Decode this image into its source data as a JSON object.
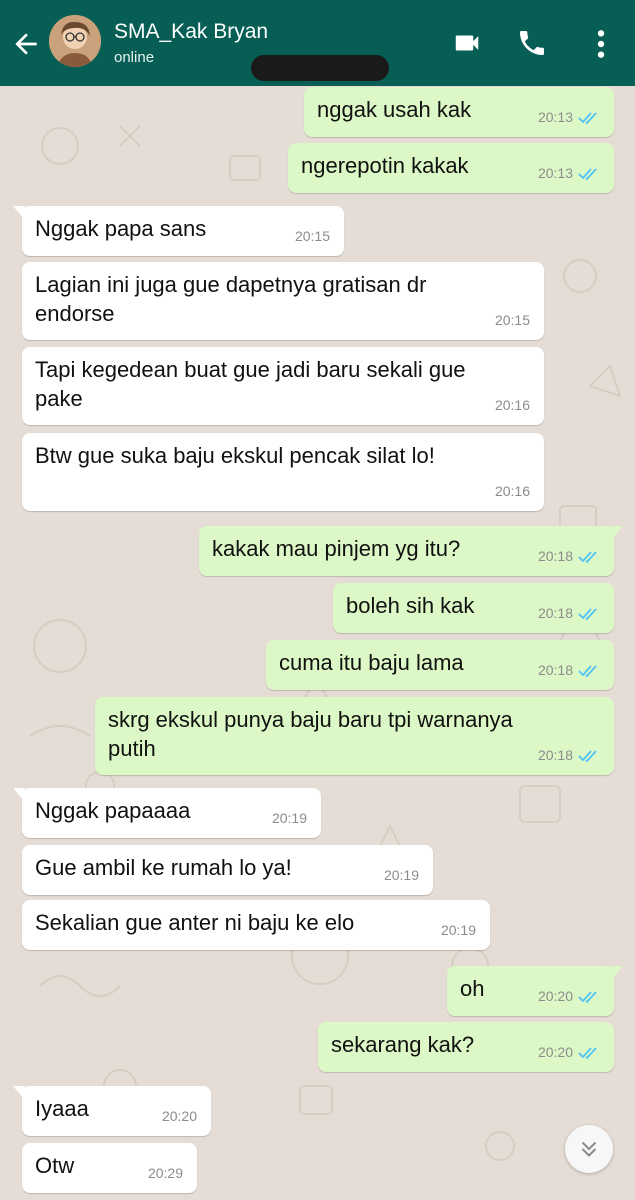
{
  "header": {
    "contact_name": "SMA_Kak Bryan",
    "status": "online",
    "icons": [
      "back-arrow-icon",
      "video-call-icon",
      "phone-icon",
      "more-vert-icon"
    ],
    "bg_color": "#075e54"
  },
  "colors": {
    "incoming_bubble": "#ffffff",
    "outgoing_bubble": "#dcf8c6",
    "read_tick": "#4fc3f7",
    "chat_background": "#e5ddd5"
  },
  "messages": [
    {
      "dir": "out",
      "text": "nggak usah kak",
      "time": "20:13",
      "read": true
    },
    {
      "dir": "out",
      "text": "ngerepotin kakak",
      "time": "20:13",
      "read": true
    },
    {
      "dir": "in",
      "text": "Nggak papa sans",
      "time": "20:15"
    },
    {
      "dir": "in",
      "text": "Lagian ini juga gue dapetnya gratisan dr\nendorse",
      "time": "20:15"
    },
    {
      "dir": "in",
      "text": "Tapi kegedean buat gue jadi baru sekali gue\npake",
      "time": "20:16"
    },
    {
      "dir": "in",
      "text": "Btw gue suka baju ekskul pencak silat lo!",
      "time": "20:16"
    },
    {
      "dir": "out",
      "text": "kakak mau pinjem yg itu?",
      "time": "20:18",
      "read": true
    },
    {
      "dir": "out",
      "text": "boleh sih kak",
      "time": "20:18",
      "read": true
    },
    {
      "dir": "out",
      "text": "cuma itu baju lama",
      "time": "20:18",
      "read": true
    },
    {
      "dir": "out",
      "text": "skrg ekskul punya baju baru tpi warnanya\nputih",
      "time": "20:18",
      "read": true
    },
    {
      "dir": "in",
      "text": "Nggak papaaaa",
      "time": "20:19"
    },
    {
      "dir": "in",
      "text": "Gue ambil ke rumah lo ya!",
      "time": "20:19"
    },
    {
      "dir": "in",
      "text": "Sekalian gue anter ni baju ke elo",
      "time": "20:19"
    },
    {
      "dir": "out",
      "text": "oh",
      "time": "20:20",
      "read": true
    },
    {
      "dir": "out",
      "text": "sekarang kak?",
      "time": "20:20",
      "read": true
    },
    {
      "dir": "in",
      "text": "Iyaaa",
      "time": "20:20"
    },
    {
      "dir": "in",
      "text": "Otw",
      "time": "20:29"
    }
  ],
  "scroll_button_icon": "chevron-double-down-icon"
}
